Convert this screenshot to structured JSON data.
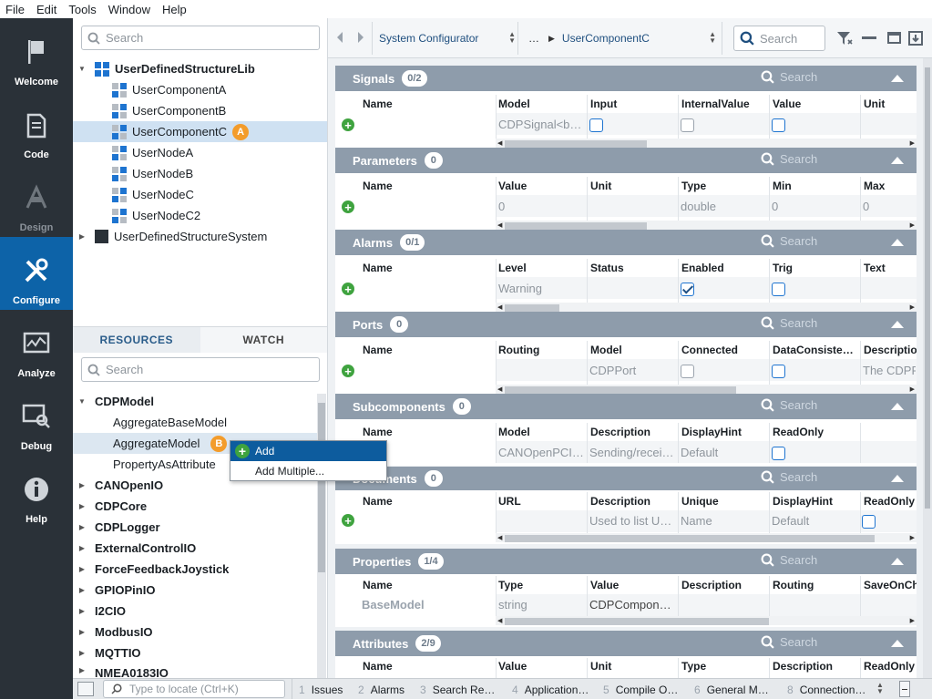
{
  "menu": [
    "File",
    "Edit",
    "Tools",
    "Window",
    "Help"
  ],
  "nav": {
    "welcome": "Welcome",
    "code": "Code",
    "design": "Design",
    "configure": "Configure",
    "analyze": "Analyze",
    "debug": "Debug",
    "help": "Help"
  },
  "project_search_placeholder": "Search",
  "project_tree": {
    "lib": "UserDefinedStructureLib",
    "children": [
      "UserComponentA",
      "UserComponentB",
      "UserComponentC",
      "UserNodeA",
      "UserNodeB",
      "UserNodeC",
      "UserNodeC2"
    ],
    "system": "UserDefinedStructureSystem",
    "selected_badge": "A"
  },
  "tabs": {
    "resources": "RESOURCES",
    "watch": "WATCH"
  },
  "resources_search_placeholder": "Search",
  "resources": {
    "cdpmodel": "CDPModel",
    "model_children": [
      "AggregateBaseModel",
      "AggregateModel",
      "PropertyAsAttribute"
    ],
    "selected_badge": "B",
    "collapsed": [
      "CANOpenIO",
      "CDPCore",
      "CDPLogger",
      "ExternalControlIO",
      "ForceFeedbackJoystick",
      "GPIOPinIO",
      "I2CIO",
      "ModbusIO",
      "MQTTIO",
      "NMEA0183IO"
    ]
  },
  "context_menu": {
    "add": "Add",
    "add_multiple": "Add Multiple..."
  },
  "toolbar": {
    "configurator": "System Configurator",
    "ellipsis": "…",
    "component": "UserComponentC",
    "search_placeholder": "Search"
  },
  "sections": {
    "signals": {
      "title": "Signals",
      "count": "0/2",
      "cols": [
        "Name",
        "Model",
        "Input",
        "InternalValue",
        "Value",
        "Unit"
      ],
      "cells": {
        "model": "CDPSignal<b…"
      }
    },
    "parameters": {
      "title": "Parameters",
      "count": "0",
      "cols": [
        "Name",
        "Value",
        "Unit",
        "Type",
        "Min",
        "Max"
      ],
      "cells": {
        "value": "0",
        "type": "double",
        "min": "0",
        "max": "0"
      }
    },
    "alarms": {
      "title": "Alarms",
      "count": "0/1",
      "cols": [
        "Name",
        "Level",
        "Status",
        "Enabled",
        "Trig",
        "Text"
      ],
      "cells": {
        "level": "Warning"
      }
    },
    "ports": {
      "title": "Ports",
      "count": "0",
      "cols": [
        "Name",
        "Routing",
        "Model",
        "Connected",
        "DataConsiste…",
        "Descriptio"
      ],
      "cells": {
        "model": "CDPPort",
        "description": "The CDPF"
      }
    },
    "subcomponents": {
      "title": "Subcomponents",
      "count": "0",
      "cols": [
        "Name",
        "Model",
        "Description",
        "DisplayHint",
        "ReadOnly"
      ],
      "cells": {
        "model": "CANOpenPCI…",
        "description": "Sending/recei…",
        "displayhint": "Default"
      }
    },
    "documents": {
      "title": "Documents",
      "count": "0",
      "cols": [
        "Name",
        "URL",
        "Description",
        "Unique",
        "DisplayHint",
        "ReadOnly"
      ],
      "cells": {
        "description": "Used to list U…",
        "unique": "Name",
        "displayhint": "Default"
      }
    },
    "properties": {
      "title": "Properties",
      "count": "1/4",
      "cols": [
        "Name",
        "Type",
        "Value",
        "Description",
        "Routing",
        "SaveOnCh"
      ],
      "cells": {
        "name": "BaseModel",
        "type": "string",
        "value": "CDPCompon…"
      }
    },
    "attributes": {
      "title": "Attributes",
      "count": "2/9",
      "cols": [
        "Name",
        "Value",
        "Unit",
        "Type",
        "Description",
        "ReadOnly"
      ]
    }
  },
  "section_search_placeholder": "Search",
  "statusbar": {
    "locate_placeholder": "Type to locate (Ctrl+K)",
    "items": [
      {
        "num": "1",
        "label": "Issues"
      },
      {
        "num": "2",
        "label": "Alarms"
      },
      {
        "num": "3",
        "label": "Search Re…"
      },
      {
        "num": "4",
        "label": "Application…"
      },
      {
        "num": "5",
        "label": "Compile O…"
      },
      {
        "num": "6",
        "label": "General M…"
      },
      {
        "num": "8",
        "label": "Connection…"
      }
    ]
  }
}
